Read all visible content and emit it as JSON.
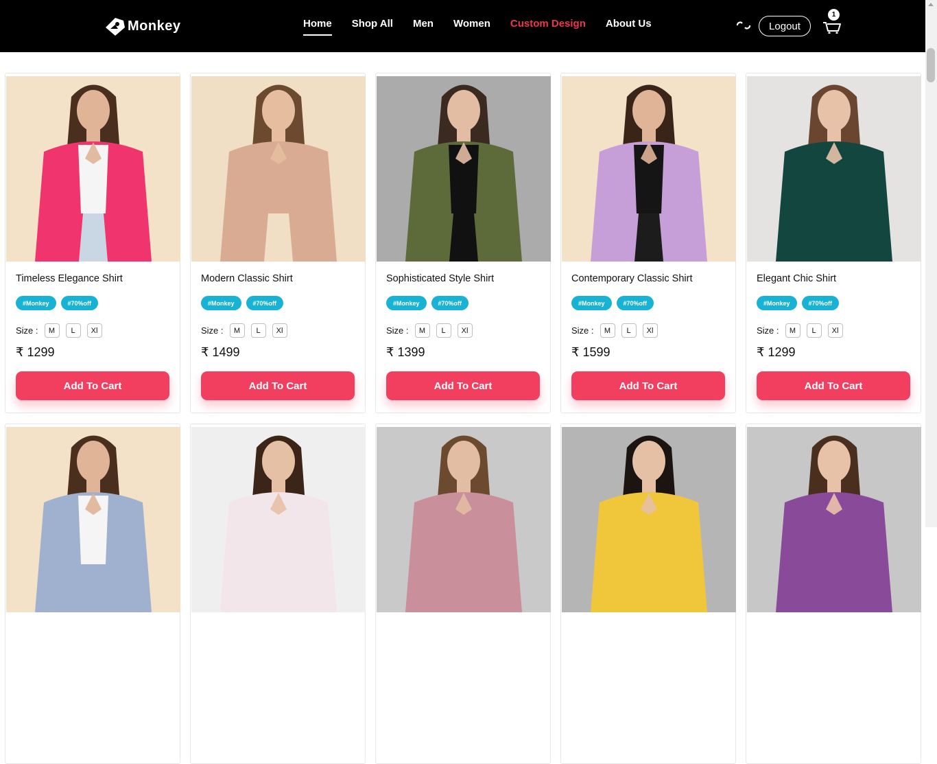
{
  "brand": {
    "name": "Monkey"
  },
  "nav": {
    "links": [
      {
        "label": "Home"
      },
      {
        "label": "Shop All"
      },
      {
        "label": "Men"
      },
      {
        "label": "Women"
      },
      {
        "label": "Custom Design"
      },
      {
        "label": "About Us"
      }
    ],
    "logout_label": "Logout",
    "cart_count": "1"
  },
  "products": [
    {
      "title": "Timeless Elegance Shirt",
      "tags": [
        "#Monkey",
        "#70%off"
      ],
      "size_label": "Size :",
      "sizes": [
        "M",
        "L",
        "Xl"
      ],
      "price": "₹ 1299",
      "button": "Add To Cart",
      "bg": "#f3e2c8",
      "skin": "#e0b497",
      "hair": "#4a2e1e",
      "garment": "#f0346d",
      "inner": "#f5f5f5",
      "lower": "#c9d6e3"
    },
    {
      "title": "Modern Classic Shirt",
      "tags": [
        "#Monkey",
        "#70%off"
      ],
      "size_label": "Size :",
      "sizes": [
        "M",
        "L",
        "Xl"
      ],
      "price": "₹ 1499",
      "button": "Add To Cart",
      "bg": "#f1dfc5",
      "skin": "#e6be9f",
      "hair": "#6b4a2f",
      "garment": "#d9ab92",
      "inner": "#d9ab92",
      "lower": "#f1dfc5"
    },
    {
      "title": "Sophisticated Style Shirt",
      "tags": [
        "#Monkey",
        "#70%off"
      ],
      "size_label": "Size :",
      "sizes": [
        "M",
        "L",
        "Xl"
      ],
      "price": "₹ 1399",
      "button": "Add To Cart",
      "bg": "#ababab",
      "skin": "#e2bca3",
      "hair": "#3b2a20",
      "garment": "#5d6b3a",
      "inner": "#111111",
      "lower": "#111111"
    },
    {
      "title": "Contemporary Classic Shirt",
      "tags": [
        "#Monkey",
        "#70%off"
      ],
      "size_label": "Size :",
      "sizes": [
        "M",
        "L",
        "Xl"
      ],
      "price": "₹ 1599",
      "button": "Add To Cart",
      "bg": "#f3e2c8",
      "skin": "#e0b497",
      "hair": "#3a2418",
      "garment": "#c69ed8",
      "inner": "#151515",
      "lower": "#1c1c1c"
    },
    {
      "title": "Elegant Chic Shirt",
      "tags": [
        "#Monkey",
        "#70%off"
      ],
      "size_label": "Size :",
      "sizes": [
        "M",
        "L",
        "Xl"
      ],
      "price": "₹ 1299",
      "button": "Add To Cart",
      "bg": "#e4e3e1",
      "skin": "#e8c2a8",
      "hair": "#6a4530",
      "garment": "#12463f",
      "inner": "#12463f",
      "lower": "#12463f"
    },
    {
      "bg": "#f3e2c8",
      "skin": "#e0b497",
      "hair": "#4a2e1e",
      "garment": "#9fb1cf",
      "inner": "#f5f5f5",
      "lower": "#9fb1cf"
    },
    {
      "bg": "#efefef",
      "skin": "#e6c0a4",
      "hair": "#3b2418",
      "garment": "#f3e6ea",
      "inner": "#f3e6ea",
      "lower": "#f3e6ea"
    },
    {
      "bg": "#c9c9c9",
      "skin": "#e2bca3",
      "hair": "#6b4a2f",
      "garment": "#c98f9a",
      "inner": "#c98f9a",
      "lower": "#c98f9a"
    },
    {
      "bg": "#b5b5b5",
      "skin": "#e6c0a4",
      "hair": "#1c1410",
      "garment": "#f0c63a",
      "inner": "#f0c63a",
      "lower": "#f0c63a"
    },
    {
      "bg": "#c7c7c7",
      "skin": "#e8c2a8",
      "hair": "#4a2e1e",
      "garment": "#8a4a9a",
      "inner": "#8a4a9a",
      "lower": "#8a4a9a"
    }
  ]
}
